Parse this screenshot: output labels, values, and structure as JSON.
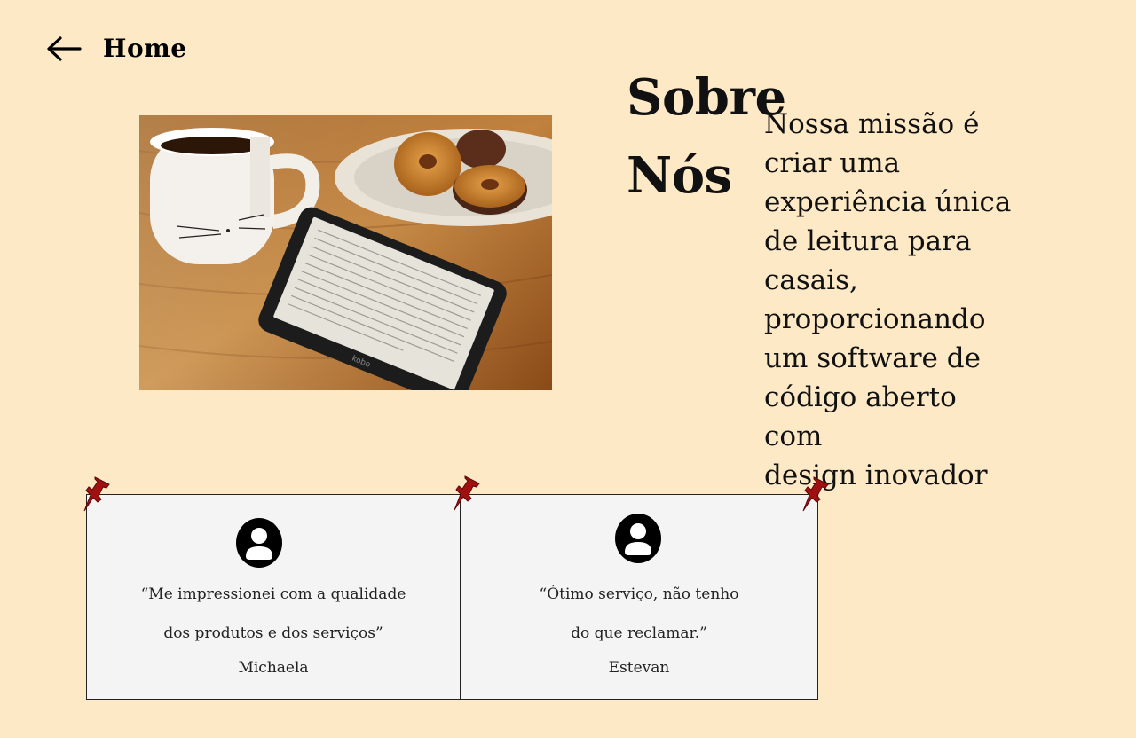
{
  "nav": {
    "back_label": "Home",
    "back_icon": "arrow-left-icon"
  },
  "hero": {
    "image_icon": "ereader-coffee-donuts-photo"
  },
  "about": {
    "title_line1": "Sobre",
    "title_line2": "Nós",
    "mission_lines": [
      "Nossa missão é",
      "criar uma",
      "experiência única",
      "de leitura para",
      "casais,",
      "proporcionando",
      "um software de",
      "código aberto com",
      "design inovador"
    ]
  },
  "testimonials": [
    {
      "quote_line1": "“Me impressionei com a qualidade",
      "quote_line2": "dos produtos e dos serviços”",
      "author": "Michaela",
      "avatar_icon": "user-avatar-icon"
    },
    {
      "quote_line1": "“Ótimo serviço, não tenho",
      "quote_line2": "do que reclamar.”",
      "author": "Estevan",
      "avatar_icon": "user-avatar-icon"
    }
  ],
  "colors": {
    "background": "#fde9c6",
    "card": "#f4f4f4",
    "pin": "#a01010"
  }
}
